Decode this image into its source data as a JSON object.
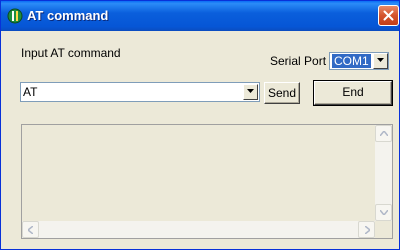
{
  "window": {
    "title": "AT command",
    "title_icon": "app-icon",
    "close_icon": "close-icon"
  },
  "form": {
    "input_label": "Input AT command",
    "command_value": "AT",
    "send_label": "Send",
    "end_label": "End",
    "serial_port_label": "Serial Port",
    "serial_port_value": "COM1"
  },
  "output": {
    "text": ""
  },
  "colors": {
    "titlebar": "#0656d6",
    "close": "#d4542e",
    "selection": "#316ac5",
    "face": "#ece9d8"
  }
}
